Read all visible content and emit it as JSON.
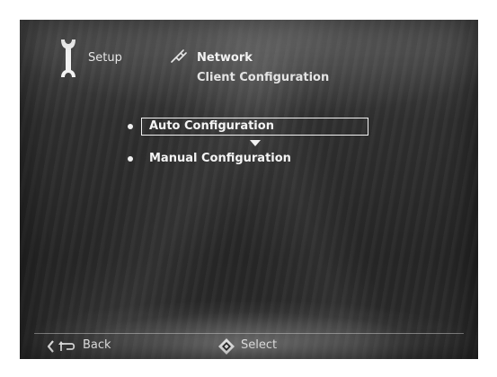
{
  "header": {
    "section_label": "Setup",
    "section_icon": "wrench-icon",
    "crumb_label": "Network",
    "crumb_icon": "network-plug-icon",
    "page_title": "Client Configuration"
  },
  "menu": {
    "options": [
      {
        "label": "Auto Configuration",
        "selected": true
      },
      {
        "label": "Manual Configuration",
        "selected": false
      }
    ]
  },
  "footer": {
    "back_label": "Back",
    "back_icon": "back-return-icon",
    "select_label": "Select",
    "select_icon": "dpad-select-icon"
  },
  "colors": {
    "text": "#f2f2f2",
    "background": "#2c2c2c"
  }
}
